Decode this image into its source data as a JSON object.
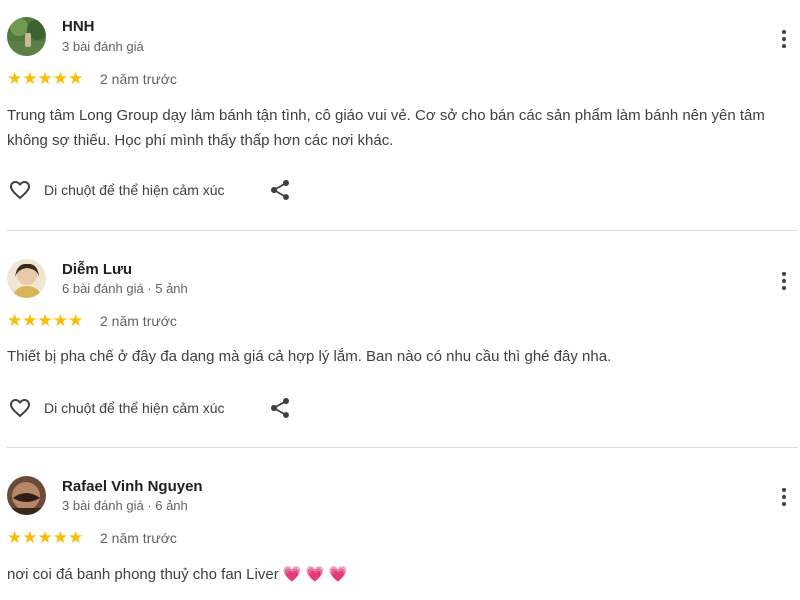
{
  "reviews": [
    {
      "name": "HNH",
      "meta": "3 bài đánh giá",
      "stars": "★★★★★",
      "rating": 5,
      "time": "2 năm trước",
      "text": "Trung tâm Long Group dạy làm bánh tận tình, cô giáo vui vẻ. Cơ sở cho bán các sản phẩm làm bánh nên yên tâm không sợ thiếu. Học phí mình thấy thấp hơn các nơi khác.",
      "like_label": "Di chuột để thể hiện cảm xúc"
    },
    {
      "name": "Diễm Lưu",
      "meta": "6 bài đánh giá · 5 ảnh",
      "stars": "★★★★★",
      "rating": 5,
      "time": "2 năm trước",
      "text": "Thiết bị pha chế ở đây đa dạng mà giá cả hợp lý lắm. Ban nào có nhu cầu thì ghé đây nha.",
      "like_label": "Di chuột để thể hiện cảm xúc"
    },
    {
      "name": "Rafael Vinh Nguyen",
      "meta": "3 bài đánh giá · 6 ảnh",
      "stars": "★★★★★",
      "rating": 5,
      "time": "2 năm trước",
      "text": "nơi coi đá banh phong thuỷ cho fan Liver",
      "emoji": "💗 💗 💗"
    }
  ],
  "colors": {
    "star": "#fbbc04",
    "heart_emoji": "#e8336f",
    "divider": "#dadce0"
  },
  "icons": {
    "like": "heart-outline-icon",
    "share": "share-icon",
    "more": "more-vert-icon"
  }
}
